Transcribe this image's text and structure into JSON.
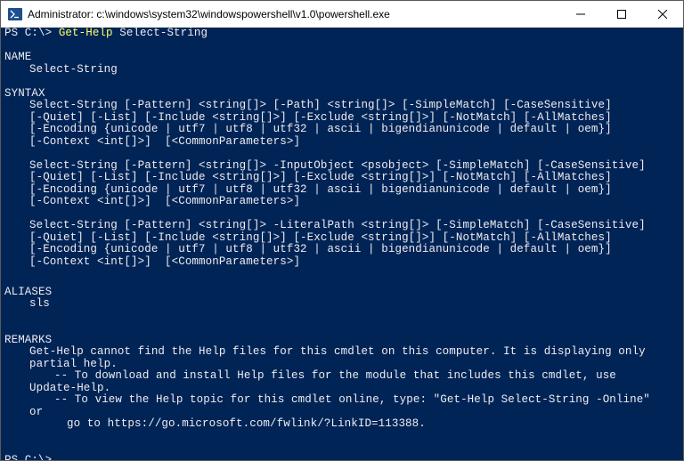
{
  "window": {
    "title": "Administrator: c:\\windows\\system32\\windowspowershell\\v1.0\\powershell.exe"
  },
  "console": {
    "prompt1": "PS C:\\> ",
    "cmd_part1": "Get-Help",
    "cmd_space": " ",
    "cmd_part2": "Select-String",
    "name_header": "NAME",
    "name_value": "Select-String",
    "syntax_header": "SYNTAX",
    "syntax_block1_l1": "Select-String [-Pattern] <string[]> [-Path] <string[]> [-SimpleMatch] [-CaseSensitive]",
    "syntax_block1_l2": "[-Quiet] [-List] [-Include <string[]>] [-Exclude <string[]>] [-NotMatch] [-AllMatches]",
    "syntax_block1_l3": "[-Encoding {unicode | utf7 | utf8 | utf32 | ascii | bigendianunicode | default | oem}]",
    "syntax_block1_l4": "[-Context <int[]>]  [<CommonParameters>]",
    "syntax_block2_l1": "Select-String [-Pattern] <string[]> -InputObject <psobject> [-SimpleMatch] [-CaseSensitive]",
    "syntax_block2_l2": "[-Quiet] [-List] [-Include <string[]>] [-Exclude <string[]>] [-NotMatch] [-AllMatches]",
    "syntax_block2_l3": "[-Encoding {unicode | utf7 | utf8 | utf32 | ascii | bigendianunicode | default | oem}]",
    "syntax_block2_l4": "[-Context <int[]>]  [<CommonParameters>]",
    "syntax_block3_l1": "Select-String [-Pattern] <string[]> -LiteralPath <string[]> [-SimpleMatch] [-CaseSensitive]",
    "syntax_block3_l2": "[-Quiet] [-List] [-Include <string[]>] [-Exclude <string[]>] [-NotMatch] [-AllMatches]",
    "syntax_block3_l3": "[-Encoding {unicode | utf7 | utf8 | utf32 | ascii | bigendianunicode | default | oem}]",
    "syntax_block3_l4": "[-Context <int[]>]  [<CommonParameters>]",
    "aliases_header": "ALIASES",
    "aliases_value": "sls",
    "remarks_header": "REMARKS",
    "remarks_l1": "Get-Help cannot find the Help files for this cmdlet on this computer. It is displaying only",
    "remarks_l2": "partial help.",
    "remarks_l3": "-- To download and install Help files for the module that includes this cmdlet, use",
    "remarks_l4": "Update-Help.",
    "remarks_l5": "-- To view the Help topic for this cmdlet online, type: \"Get-Help Select-String -Online\"",
    "remarks_l6": "or",
    "remarks_l7": "go to https://go.microsoft.com/fwlink/?LinkID=113388.",
    "prompt2": "PS C:\\> "
  }
}
